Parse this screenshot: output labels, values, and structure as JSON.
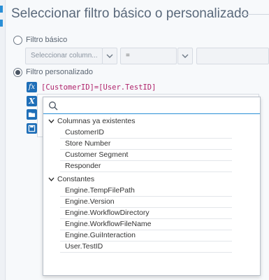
{
  "dialog": {
    "title": "Seleccionar filtro básico o personalizado"
  },
  "basic_filter": {
    "label": "Filtro básico",
    "selected": false,
    "column_select": "Seleccionar column...",
    "operator_select": "=",
    "value_select": ""
  },
  "custom_filter": {
    "label": "Filtro personalizado",
    "selected": true,
    "expression": "[CustomerID]=[User.TestID]"
  },
  "toolbar_icons": [
    "function-icon",
    "variable-icon",
    "open-folder-icon",
    "save-icon"
  ],
  "dropdown": {
    "search_value": "",
    "groups": [
      {
        "label": "Columnas ya existentes",
        "items": [
          "CustomerID",
          "Store Number",
          "Customer Segment",
          "Responder"
        ]
      },
      {
        "label": "Constantes",
        "items": [
          "Engine.TempFilePath",
          "Engine.Version",
          "Engine.WorkflowDirectory",
          "Engine.WorkflowFileName",
          "Engine.GuiInteraction",
          "User.TestID"
        ]
      }
    ]
  },
  "colors": {
    "accent": "#2a8fd6",
    "icon_blue": "#1f6fb8",
    "expression": "#b0236b",
    "title": "#59687a"
  }
}
